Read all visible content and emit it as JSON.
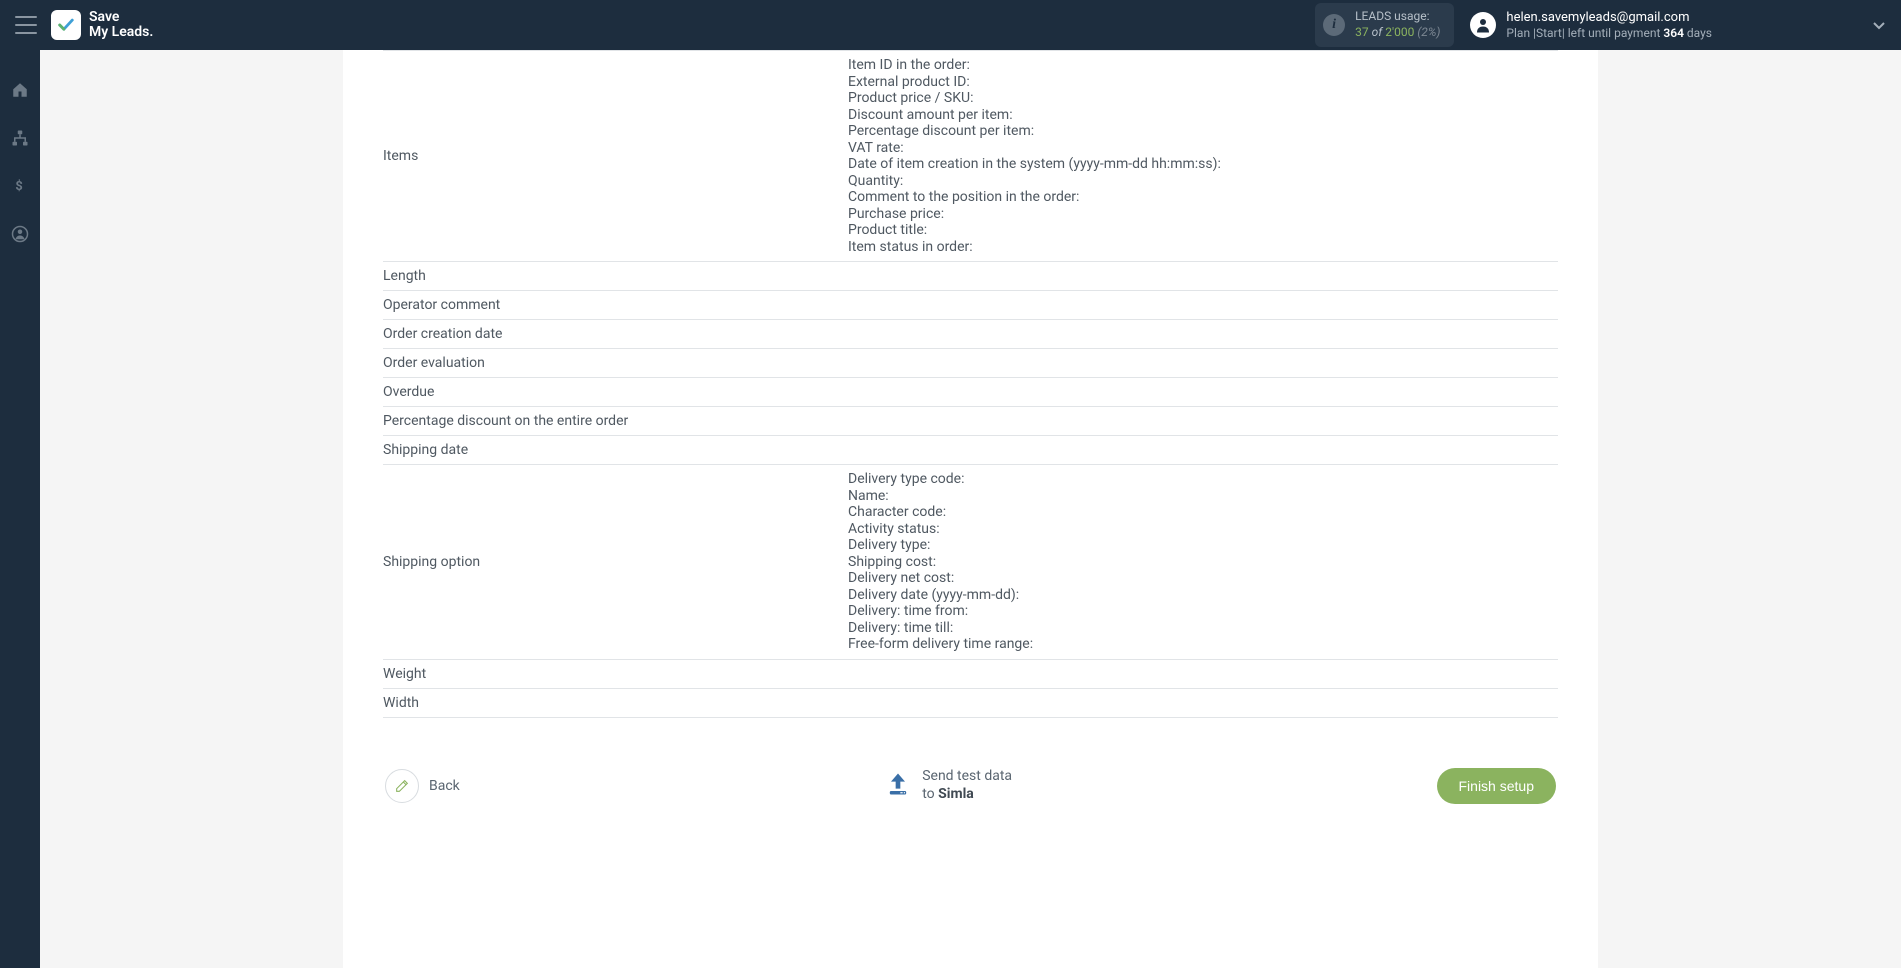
{
  "header": {
    "logo_line1": "Save",
    "logo_line2": "My Leads.",
    "usage": {
      "label": "LEADS usage:",
      "current": "37",
      "of_word": "of",
      "total": "2'000",
      "percent": "(2%)"
    },
    "account": {
      "email": "helen.savemyleads@gmail.com",
      "plan_prefix": "Plan |Start| left until payment ",
      "days": "364",
      "days_suffix": " days"
    }
  },
  "fields": [
    {
      "label": "Items",
      "lines": [
        "Item ID in the order:",
        "External product ID:",
        "Product price / SKU:",
        "Discount amount per item:",
        "Percentage discount per item:",
        "VAT rate:",
        "Date of item creation in the system (yyyy-mm-dd hh:mm:ss):",
        "Quantity:",
        "Comment to the position in the order:",
        "Purchase price:",
        "Product title:",
        "Item status in order:"
      ]
    },
    {
      "label": "Length",
      "lines": []
    },
    {
      "label": "Operator comment",
      "lines": []
    },
    {
      "label": "Order creation date",
      "lines": []
    },
    {
      "label": "Order evaluation",
      "lines": []
    },
    {
      "label": "Overdue",
      "lines": []
    },
    {
      "label": "Percentage discount on the entire order",
      "lines": []
    },
    {
      "label": "Shipping date",
      "lines": []
    },
    {
      "label": "Shipping option",
      "lines": [
        "Delivery type code:",
        "Name:",
        "Character code:",
        "Activity status:",
        "Delivery type:",
        "Shipping cost:",
        "Delivery net cost:",
        "Delivery date (yyyy-mm-dd):",
        "Delivery: time from:",
        "Delivery: time till:",
        "Free-form delivery time range:"
      ]
    },
    {
      "label": "Weight",
      "lines": []
    },
    {
      "label": "Width",
      "lines": []
    }
  ],
  "footer": {
    "back_label": "Back",
    "send_test_line1": "Send test data",
    "send_test_line2_prefix": "to ",
    "send_test_target": "Simla",
    "finish_label": "Finish setup"
  }
}
